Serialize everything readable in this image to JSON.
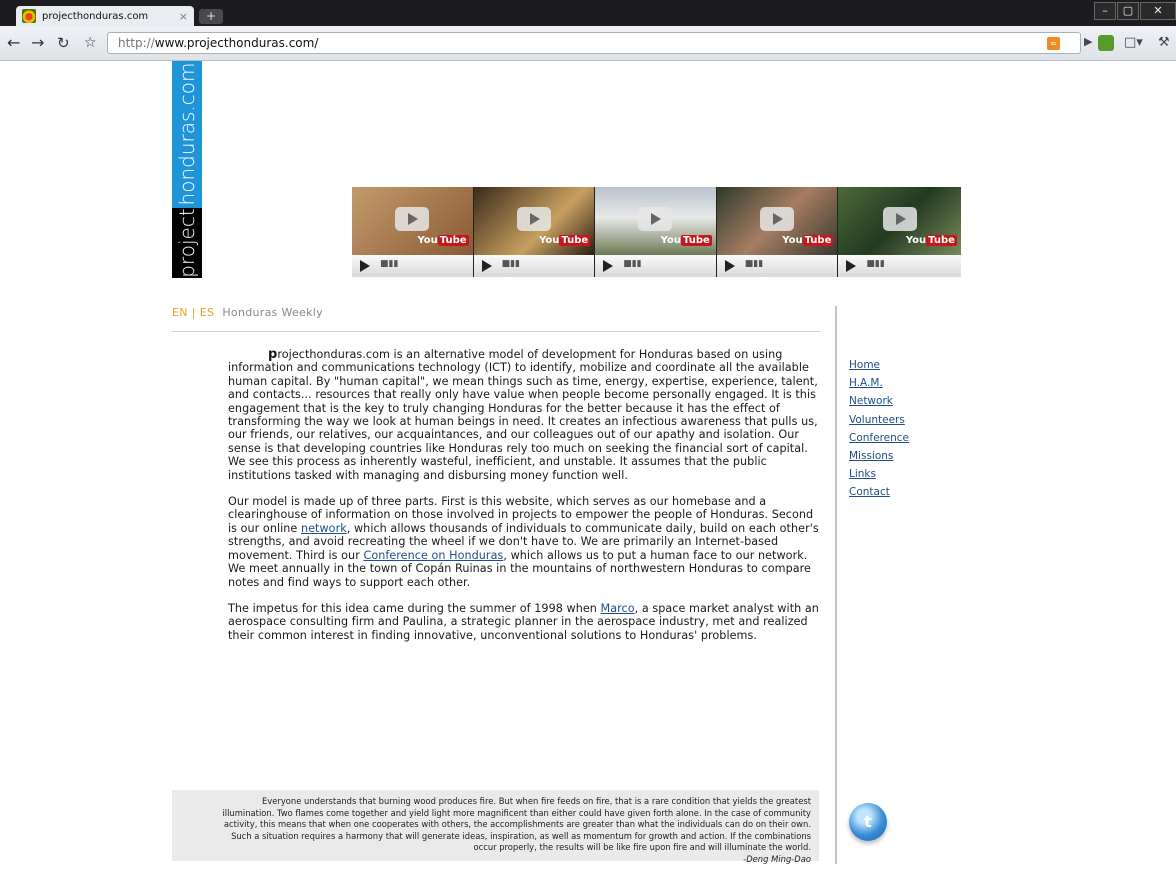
{
  "browser": {
    "tab_title": "projecthonduras.com",
    "tab_close": "×",
    "new_tab": "+",
    "window_controls": [
      "–",
      "▢",
      "✕"
    ],
    "url_protocol": "http://",
    "url_host": "www.projecthonduras.com/",
    "rss_label": "RSS"
  },
  "logo": {
    "blue_text": "honduras.com",
    "black_text": "project"
  },
  "videos": [
    {
      "yt_you": "You",
      "yt_tube": "Tube"
    },
    {
      "yt_you": "You",
      "yt_tube": "Tube"
    },
    {
      "yt_you": "You",
      "yt_tube": "Tube"
    },
    {
      "yt_you": "You",
      "yt_tube": "Tube"
    },
    {
      "yt_you": "You",
      "yt_tube": "Tube"
    }
  ],
  "lang": {
    "en": "EN",
    "sep": "|",
    "es": "ES",
    "weekly": "Honduras Weekly"
  },
  "content": {
    "p1_first_letter": "p",
    "p1_rest": "rojecthonduras.com is an alternative model of development for Honduras based on using information and communications technology (ICT) to identify, mobilize and coordinate all the available human capital. By \"human capital\", we mean things such as time, energy, expertise, experience, talent, and contacts... resources that really only have value when people become personally engaged. It is this engagement that is the key to truly changing Honduras for the better because it has the effect of transforming the way we look at human beings in need. It creates an infectious awareness that pulls us, our friends, our relatives, our acquaintances, and our colleagues out of our apathy and isolation. Our sense is that developing countries like Honduras rely too much on seeking the financial sort of capital. We see this process as inherently wasteful, inefficient, and unstable. It assumes that the public institutions tasked with managing and disbursing money function well.",
    "p2_a": "Our model is made up of three parts. First is this website, which serves as our homebase and a clearinghouse of information on those involved in projects to empower the people of Honduras. Second is our online ",
    "p2_link1": "network",
    "p2_b": ", which allows thousands of individuals to communicate daily, build on each other's strengths, and avoid recreating the wheel if we don't have to. We are primarily an Internet-based movement. Third is our ",
    "p2_link2": "Conference on Honduras",
    "p2_c": ", which allows us to put a human face to our network. We meet annually in the town of Copán Ruinas in the mountains of northwestern Honduras to compare notes and find ways to support each other.",
    "p3_a": "The impetus for this idea came during the summer of 1998 when ",
    "p3_link": "Marco",
    "p3_b": ", a space market analyst with an aerospace consulting firm and Paulina, a strategic planner in the aerospace industry, met and realized their common interest in finding innovative, unconventional solutions to Honduras' problems."
  },
  "nav": {
    "items": [
      "Home",
      "H.A.M.",
      "Network",
      "Volunteers",
      "Conference",
      "Missions",
      "Links",
      "Contact"
    ]
  },
  "quote": {
    "text": "Everyone understands that burning wood produces fire. But when fire feeds on fire, that is a rare condition that yields the greatest illumination. Two flames come together and yield light more magnificent than either could have given forth alone. In the case of community activity, this means that when one cooperates with others, the accomplishments are greater than what the individuals can do on their own. Such a situation requires a harmony that will generate ideas, inspiration, as well as momentum for growth and action. If the combinations occur properly, the results will be like fire upon fire and will illuminate the world.",
    "author": "-Deng Ming-Dao"
  },
  "colors": {
    "logo_blue": "#1e95d9",
    "lang_orange": "#f29d24",
    "link_blue": "#1f4e8c"
  }
}
